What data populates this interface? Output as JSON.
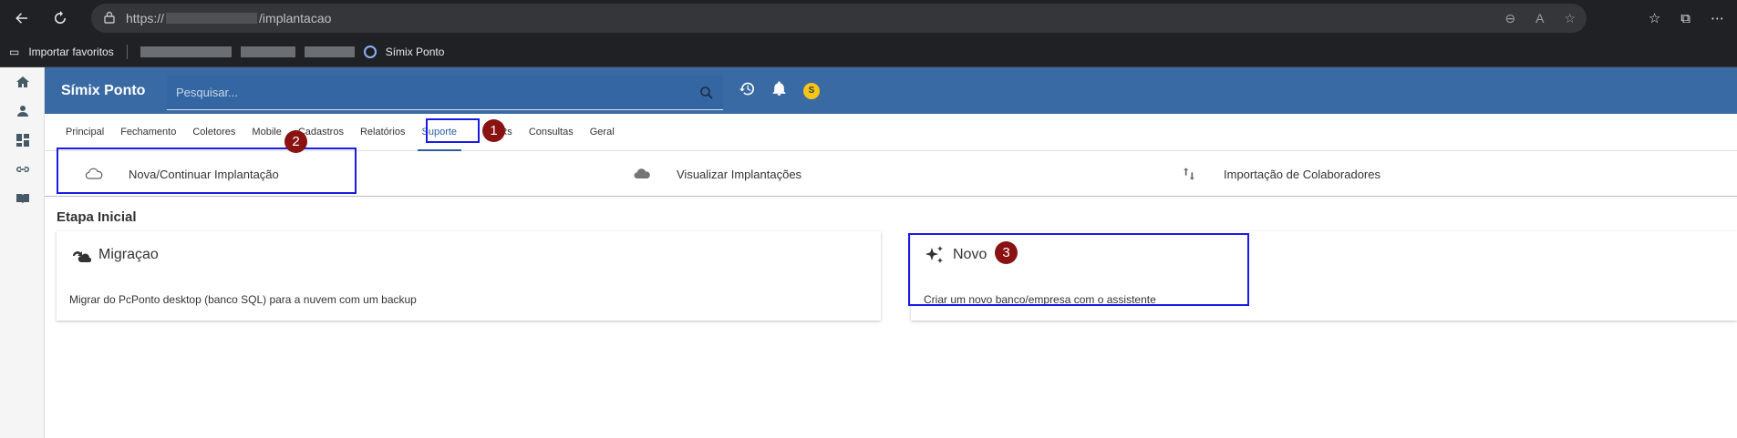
{
  "browser": {
    "url_prefix": "https://",
    "url_path": "/implantacao",
    "favorites_label": "Importar favoritos",
    "favorite_app": "Símix Ponto"
  },
  "app": {
    "brand": "Símix Ponto",
    "search_placeholder": "Pesquisar...",
    "avatar_initial": "S"
  },
  "tabs": [
    {
      "label": "Principal"
    },
    {
      "label": "Fechamento"
    },
    {
      "label": "Coletores"
    },
    {
      "label": "Mobile"
    },
    {
      "label": "Cadastros"
    },
    {
      "label": "Relatórios"
    },
    {
      "label": "Suporte",
      "active": true
    },
    {
      "label": "VRs"
    },
    {
      "label": "Consultas"
    },
    {
      "label": "Geral"
    }
  ],
  "subnav": [
    {
      "label": "Nova/Continuar Implantação",
      "icon": "cloud-outline-icon"
    },
    {
      "label": "Visualizar Implantações",
      "icon": "cloud-icon"
    },
    {
      "label": "Importação de Colaboradores",
      "icon": "swap-vertical-icon"
    }
  ],
  "section": {
    "title": "Etapa Inicial"
  },
  "cards": [
    {
      "title": "Migraçao",
      "description": "Migrar do PcPonto desktop (banco SQL) para a nuvem com um backup",
      "icon": "cloud-sync-icon"
    },
    {
      "title": "Novo",
      "description": "Criar um novo banco/empresa com o assistente",
      "icon": "sparkles-icon"
    }
  ],
  "annotations": {
    "badge1": "1",
    "badge2": "2",
    "badge3": "3",
    "highlight_color": "#1a1ae6",
    "badge_color": "#8a1212"
  },
  "colors": {
    "topbar": "#3a6aa3",
    "active_tab": "#2b5fa0"
  }
}
